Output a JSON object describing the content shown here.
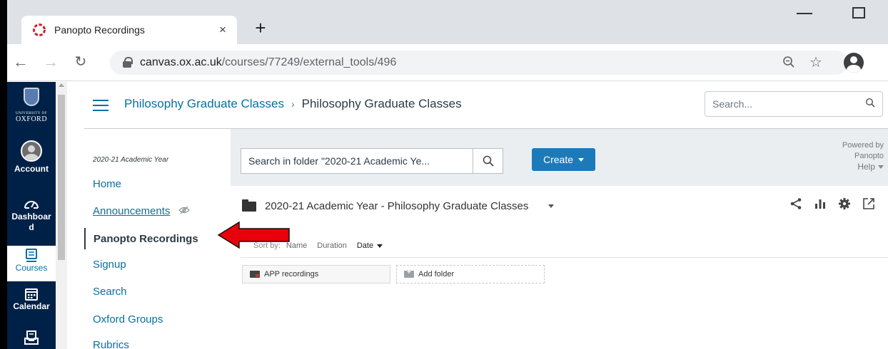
{
  "browser": {
    "tab_title": "Panopto Recordings",
    "tab_close": "×",
    "new_tab": "+",
    "url_host": "canvas.ox.ac.uk",
    "url_path": "/courses/77249/external_tools/496"
  },
  "global_nav": {
    "logo_university": "UNIVERSITY OF",
    "logo_name": "OXFORD",
    "items": [
      {
        "label": "Account",
        "icon": "account-avatar-icon"
      },
      {
        "label": "Dashboard",
        "icon": "dashboard-icon"
      },
      {
        "label": "Courses",
        "icon": "courses-icon"
      },
      {
        "label": "Calendar",
        "icon": "calendar-icon"
      },
      {
        "label": "",
        "icon": "inbox-icon"
      }
    ]
  },
  "header": {
    "breadcrumb_course": "Philosophy Graduate Classes",
    "breadcrumb_separator": "›",
    "breadcrumb_current": "Philosophy Graduate Classes",
    "search_placeholder": "Search..."
  },
  "course_nav": {
    "term": "2020-21 Academic Year",
    "items": [
      {
        "label": "Home"
      },
      {
        "label": "Announcements"
      },
      {
        "label": "Panopto Recordings"
      },
      {
        "label": "Signup"
      },
      {
        "label": "Search"
      },
      {
        "label": "Oxford Groups"
      },
      {
        "label": "Rubrics"
      }
    ]
  },
  "panopto": {
    "search_placeholder": "Search in folder \"2020-21 Academic Ye...",
    "create_label": "Create",
    "powered_by": "Powered by",
    "powered_brand": "Panopto",
    "help_label": "Help",
    "folder_title": "2020-21 Academic Year - Philosophy Graduate Classes",
    "sort_prefix": "Sort by:",
    "sort_options": [
      "Name",
      "Duration",
      "Date"
    ],
    "active_sort": "Date",
    "subfolders": [
      {
        "name": "APP recordings"
      }
    ],
    "add_folder_label": "Add folder"
  },
  "colors": {
    "canvas_nav_bg": "#002147",
    "link_blue": "#0770a3",
    "create_button": "#1d7ab8",
    "annotation_arrow": "#e8000b"
  }
}
